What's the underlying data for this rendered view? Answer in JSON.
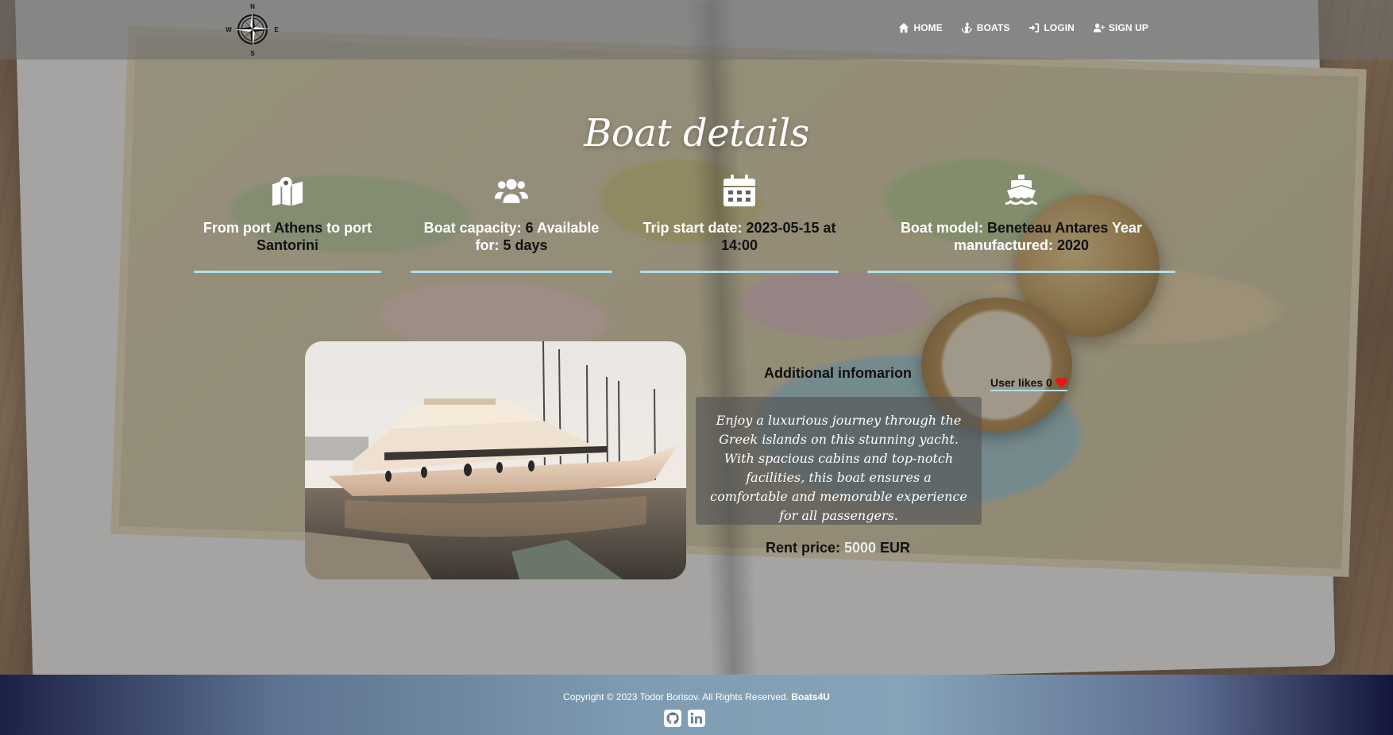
{
  "nav": {
    "links": [
      {
        "label": "HOME",
        "icon": "home-icon"
      },
      {
        "label": "BOATS",
        "icon": "anchor-icon"
      },
      {
        "label": "LOGIN",
        "icon": "sign-in-icon"
      },
      {
        "label": "SIGN UP",
        "icon": "user-plus-icon"
      }
    ],
    "logo_letters": {
      "n": "N",
      "e": "E",
      "s": "S",
      "w": "W"
    }
  },
  "page": {
    "title": "Boat details"
  },
  "features": {
    "route": {
      "icon": "map-marker-icon",
      "from_label": "From port ",
      "from_value": "Athens",
      "to_label": " to port ",
      "to_value": "Santorini"
    },
    "capacity": {
      "icon": "users-icon",
      "label": "Boat capacity: ",
      "value": "6",
      "available_label": " Available for: ",
      "available_value": "5 days"
    },
    "start": {
      "icon": "calendar-icon",
      "label": "Trip start date: ",
      "value": "2023-05-15 at 14:00"
    },
    "model": {
      "icon": "ship-icon",
      "label": "Boat model: ",
      "value": "Beneteau Antares",
      "year_label": " Year manufactured: ",
      "year_value": "2020"
    }
  },
  "details": {
    "additional_title": "Additional infomarion",
    "likes_label": "User likes",
    "likes_count": "0",
    "description": "Enjoy a luxurious journey through the Greek islands on this stunning yacht. With spacious cabins and top-notch facilities, this boat ensures a comfortable and memorable experience for all passengers.",
    "rent_label": "Rent price: ",
    "rent_value": "5000",
    "rent_currency": " EUR"
  },
  "footer": {
    "copyright": "Copyright © 2023 Todor Borisov. All Rights Reserved. ",
    "brand": "Boats4U",
    "socials": [
      "github-icon",
      "linkedin-icon"
    ]
  },
  "colors": {
    "accent_line": "#aee0ee",
    "heart": "#e8121b",
    "navbar_bg": "rgba(110,110,110,0.55)"
  }
}
